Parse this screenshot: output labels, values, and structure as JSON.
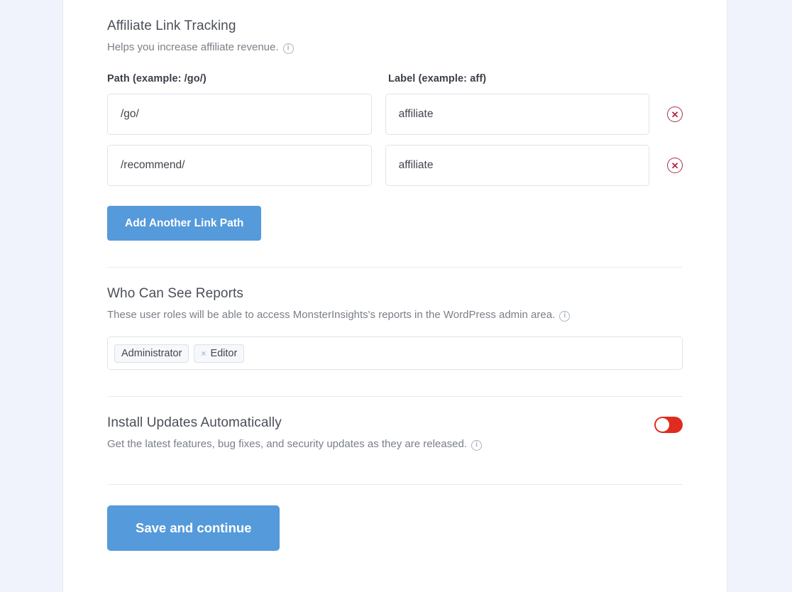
{
  "affiliate": {
    "title": "Affiliate Link Tracking",
    "description": "Helps you increase affiliate revenue.",
    "info_icon": "info-icon",
    "columns": {
      "path": "Path (example: /go/)",
      "label": "Label (example: aff)"
    },
    "rows": [
      {
        "path": "/go/",
        "label": "affiliate",
        "remove_icon": "remove-circle-icon"
      },
      {
        "path": "/recommend/",
        "label": "affiliate",
        "remove_icon": "remove-circle-icon"
      }
    ],
    "add_button": "Add Another Link Path"
  },
  "reports": {
    "title": "Who Can See Reports",
    "description": "These user roles will be able to access MonsterInsights's reports in the WordPress admin area.",
    "info_icon": "info-icon",
    "tags": [
      {
        "label": "Administrator",
        "removable": false
      },
      {
        "label": "Editor",
        "removable": true,
        "remove_glyph": "×"
      }
    ]
  },
  "updates": {
    "title": "Install Updates Automatically",
    "description": "Get the latest features, bug fixes, and security updates as they are released.",
    "info_icon": "info-icon",
    "toggle_state": "off"
  },
  "footer": {
    "save_button": "Save and continue"
  },
  "colors": {
    "page_background": "#f0f3fb",
    "card_background": "#ffffff",
    "primary_button": "#559ada",
    "remove_icon": "#b32b45",
    "toggle_on": "#e02b20",
    "divider": "#e8eaee",
    "input_border": "#dfe3e9",
    "heading_text": "#4b4f58",
    "muted_text": "#7a7f87"
  }
}
